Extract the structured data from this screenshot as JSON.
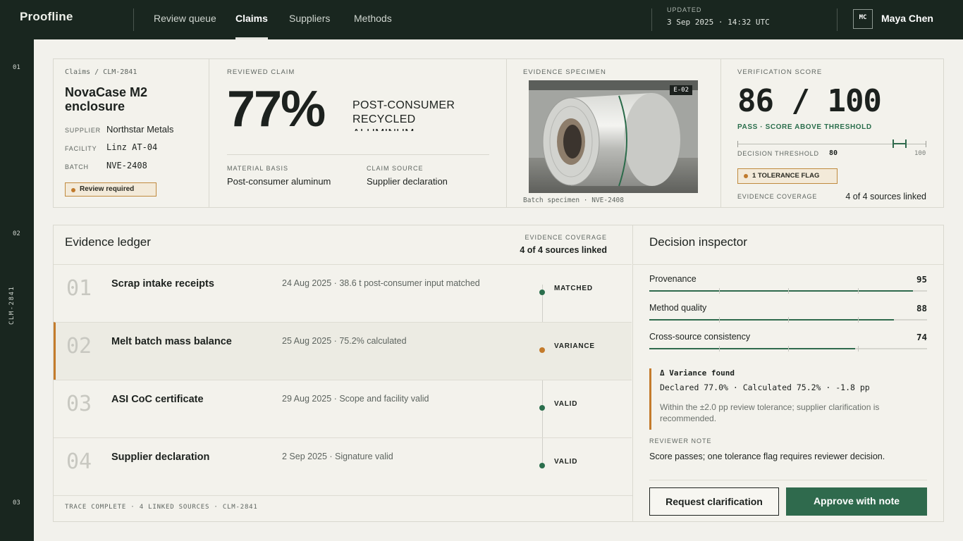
{
  "app": {
    "brand": "Proofline"
  },
  "nav": {
    "items": [
      "Review queue",
      "Claims",
      "Suppliers",
      "Methods"
    ],
    "active": "Claims"
  },
  "updated": {
    "label": "UPDATED",
    "value": "3 Sep 2025 · 14:32 UTC"
  },
  "user": {
    "initials": "MC",
    "name": "Maya Chen"
  },
  "rail": {
    "sections": [
      "01",
      "02",
      "03"
    ],
    "claim_id": "CLM-2841"
  },
  "claim": {
    "breadcrumb": "Claims / CLM-2841",
    "product": "NovaCase M2 enclosure",
    "supplier_label": "SUPPLIER",
    "supplier": "Northstar Metals",
    "facility_label": "FACILITY",
    "facility": "Linz AT-04",
    "batch_label": "BATCH",
    "batch": "NVE-2408",
    "status": "Review required"
  },
  "reviewed_claim": {
    "label": "REVIEWED CLAIM",
    "percent": "77%",
    "material": "POST-CONSUMER RECYCLED ALUMINUM",
    "basis_label": "MATERIAL BASIS",
    "basis": "Post-consumer aluminum",
    "source_label": "CLAIM SOURCE",
    "source": "Supplier declaration"
  },
  "specimen": {
    "label": "EVIDENCE SPECIMEN",
    "tag": "E-02",
    "caption": "Batch specimen · NVE-2408"
  },
  "verification": {
    "label": "VERIFICATION SCORE",
    "score": "86 / 100",
    "score_value": 86,
    "status": "PASS · SCORE ABOVE THRESHOLD",
    "threshold_label": "DECISION THRESHOLD",
    "threshold": "80",
    "max": "100",
    "flag": "1 TOLERANCE FLAG",
    "coverage_label": "EVIDENCE COVERAGE",
    "coverage": "4 of 4 sources linked"
  },
  "ledger": {
    "title": "Evidence ledger",
    "coverage_label": "EVIDENCE COVERAGE",
    "coverage": "4 of 4 sources linked",
    "rows": [
      {
        "num": "01",
        "title": "Scrap intake receipts",
        "meta": "24 Aug 2025 · 38.6 t post-consumer input matched",
        "status": "MATCHED",
        "color": "#2a6e4c"
      },
      {
        "num": "02",
        "title": "Melt batch mass balance",
        "meta": "25 Aug 2025 · 75.2% calculated",
        "status": "VARIANCE",
        "color": "#c47b2c"
      },
      {
        "num": "03",
        "title": "ASI CoC certificate",
        "meta": "29 Aug 2025 · Scope and facility valid",
        "status": "VALID",
        "color": "#2a6e4c"
      },
      {
        "num": "04",
        "title": "Supplier declaration",
        "meta": "2 Sep 2025 · Signature valid",
        "status": "VALID",
        "color": "#2a6e4c"
      }
    ],
    "footer": "TRACE COMPLETE · 4 LINKED SOURCES · CLM-2841"
  },
  "inspector": {
    "title": "Decision inspector",
    "metrics": [
      {
        "label": "Provenance",
        "value": "95",
        "score": 95
      },
      {
        "label": "Method quality",
        "value": "88",
        "score": 88
      },
      {
        "label": "Cross-source consistency",
        "value": "74",
        "score": 74
      }
    ],
    "variance_title": "Δ Variance found",
    "variance_values": "Declared 77.0% · Calculated 75.2% · -1.8 pp",
    "variance_note": "Within the ±2.0 pp review tolerance; supplier clarification is recommended.",
    "note_label": "REVIEWER NOTE",
    "note": "Score passes; one tolerance flag requires reviewer decision.",
    "request_button": "Request clarification",
    "approve_button": "Approve with note"
  },
  "colors": {
    "dark": "#19261f",
    "accent_green": "#2f6a4d",
    "warning": "#c47b2c"
  }
}
